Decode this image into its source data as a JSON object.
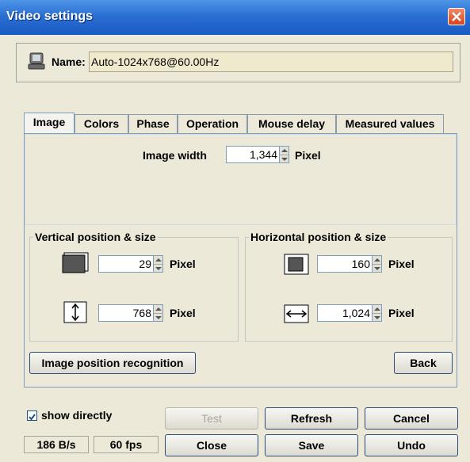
{
  "window": {
    "title": "Video settings"
  },
  "name_panel": {
    "label": "Name:",
    "value": "Auto-1024x768@60.00Hz"
  },
  "tabs": [
    {
      "label": "Image",
      "active": true
    },
    {
      "label": "Colors"
    },
    {
      "label": "Phase"
    },
    {
      "label": "Operation"
    },
    {
      "label": "Mouse delay"
    },
    {
      "label": "Measured values"
    }
  ],
  "image_tab": {
    "image_width": {
      "label": "Image width",
      "value": "1,344",
      "unit": "Pixel"
    },
    "vertical": {
      "title": "Vertical position & size",
      "position": {
        "value": "29",
        "unit": "Pixel"
      },
      "size": {
        "value": "768",
        "unit": "Pixel"
      }
    },
    "horizontal": {
      "title": "Horizontal position & size",
      "position": {
        "value": "160",
        "unit": "Pixel"
      },
      "size": {
        "value": "1,024",
        "unit": "Pixel"
      }
    },
    "recognition_button": "Image position recognition",
    "back_button": "Back"
  },
  "footer": {
    "show_directly": {
      "label": "show directly",
      "checked": true
    },
    "bitrate": "186 B/s",
    "fps": "60 fps",
    "buttons": {
      "test": "Test",
      "refresh": "Refresh",
      "cancel": "Cancel",
      "close": "Close",
      "save": "Save",
      "undo": "Undo"
    }
  },
  "colors": {
    "titlebar": "#2a6fd3",
    "window_bg": "#ece9d8",
    "name_field_bg": "#efeace"
  }
}
